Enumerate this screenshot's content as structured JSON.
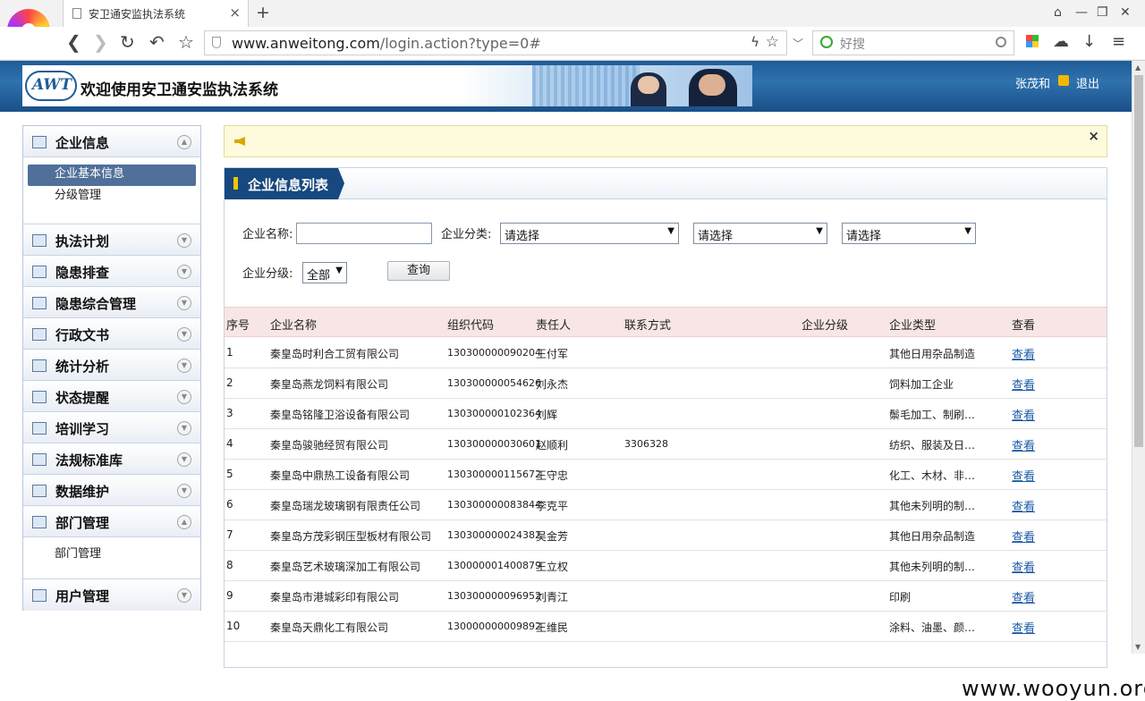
{
  "browser": {
    "tab_title": "安卫通安监执法系统",
    "tab_close": "×",
    "new_tab": "+",
    "url_host": "www.anweitong.com",
    "url_path": "/login.action?type=0#",
    "search_placeholder": "好搜",
    "window_buttons": [
      "⌂",
      "—",
      "❐",
      "✕"
    ]
  },
  "header": {
    "logo_text": "AWT",
    "banner_title": "欢迎使用安卫通安监执法系统",
    "username": "张茂和",
    "logout": "退出"
  },
  "sidebar": {
    "sections": [
      {
        "label": "企业信息",
        "icon": "org-chart-icon",
        "expanded": true,
        "items": [
          "企业基本信息",
          "分级管理"
        ],
        "active": 0
      },
      {
        "label": "执法计划",
        "icon": "calendar-icon",
        "expanded": false
      },
      {
        "label": "隐患排查",
        "icon": "magnifier-icon",
        "expanded": false
      },
      {
        "label": "隐患综合管理",
        "icon": "warning-doc-icon",
        "expanded": false
      },
      {
        "label": "行政文书",
        "icon": "document-icon",
        "expanded": false
      },
      {
        "label": "统计分析",
        "icon": "chart-icon",
        "expanded": false
      },
      {
        "label": "状态提醒",
        "icon": "chat-bubble-icon",
        "expanded": false
      },
      {
        "label": "培训学习",
        "icon": "keyboard-icon",
        "expanded": false
      },
      {
        "label": "法规标准库",
        "icon": "gavel-icon",
        "expanded": false
      },
      {
        "label": "数据维护",
        "icon": "checklist-icon",
        "expanded": false
      },
      {
        "label": "部门管理",
        "icon": "hierarchy-icon",
        "expanded": true,
        "items": [
          "部门管理"
        ]
      },
      {
        "label": "用户管理",
        "icon": "user-icon",
        "expanded": false
      }
    ]
  },
  "notice": {
    "close": "×"
  },
  "panel": {
    "title": "企业信息列表",
    "filters": {
      "name_label": "企业名称:",
      "name_value": "",
      "category_label": "企业分类:",
      "category_selects": [
        "请选择",
        "请选择",
        "请选择"
      ],
      "level_label": "企业分级:",
      "level_value": "全部",
      "query_button": "查询"
    },
    "columns": [
      "序号",
      "企业名称",
      "组织代码",
      "责任人",
      "联系方式",
      "企业分级",
      "企业类型",
      "查看"
    ],
    "rows": [
      {
        "no": "1",
        "name": "秦皇岛时利合工贸有限公司",
        "code": "130300000090204",
        "person": "王付军",
        "contact": "",
        "level": "",
        "type": "其他日用杂品制造",
        "view": "查看"
      },
      {
        "no": "2",
        "name": "秦皇岛燕龙饲料有限公司",
        "code": "130300000054626",
        "person": "刘永杰",
        "contact": "",
        "level": "",
        "type": "饲料加工企业",
        "view": "查看"
      },
      {
        "no": "3",
        "name": "秦皇岛铭隆卫浴设备有限公司",
        "code": "130300000102364",
        "person": "刘辉",
        "contact": "",
        "level": "",
        "type": "鬃毛加工、制刷…",
        "view": "查看"
      },
      {
        "no": "4",
        "name": "秦皇岛骏驰经贸有限公司",
        "code": "130300000030601",
        "person": "赵顺利",
        "contact": "3306328",
        "level": "",
        "type": "纺织、服装及日…",
        "view": "查看"
      },
      {
        "no": "5",
        "name": "秦皇岛中鼎热工设备有限公司",
        "code": "130300000115672",
        "person": "王守忠",
        "contact": "",
        "level": "",
        "type": "化工、木材、非…",
        "view": "查看"
      },
      {
        "no": "6",
        "name": "秦皇岛瑞龙玻璃钢有限责任公司",
        "code": "130300000083844",
        "person": "李克平",
        "contact": "",
        "level": "",
        "type": "其他未列明的制…",
        "view": "查看"
      },
      {
        "no": "7",
        "name": "秦皇岛方茂彩钢压型板材有限公司",
        "code": "130300000024382",
        "person": "吴金芳",
        "contact": "",
        "level": "",
        "type": "其他日用杂品制造",
        "view": "查看"
      },
      {
        "no": "8",
        "name": "秦皇岛艺术玻璃深加工有限公司",
        "code": "130000001400879",
        "person": "王立权",
        "contact": "",
        "level": "",
        "type": "其他未列明的制…",
        "view": "查看"
      },
      {
        "no": "9",
        "name": "秦皇岛市港城彩印有限公司",
        "code": "130300000096952",
        "person": "刘青江",
        "contact": "",
        "level": "",
        "type": "印刷",
        "view": "查看"
      },
      {
        "no": "10",
        "name": "秦皇岛天鼎化工有限公司",
        "code": "130000000009892",
        "person": "王维民",
        "contact": "",
        "level": "",
        "type": "涂料、油墨、颜…",
        "view": "查看"
      }
    ]
  },
  "watermark": "www.wooyun.org"
}
